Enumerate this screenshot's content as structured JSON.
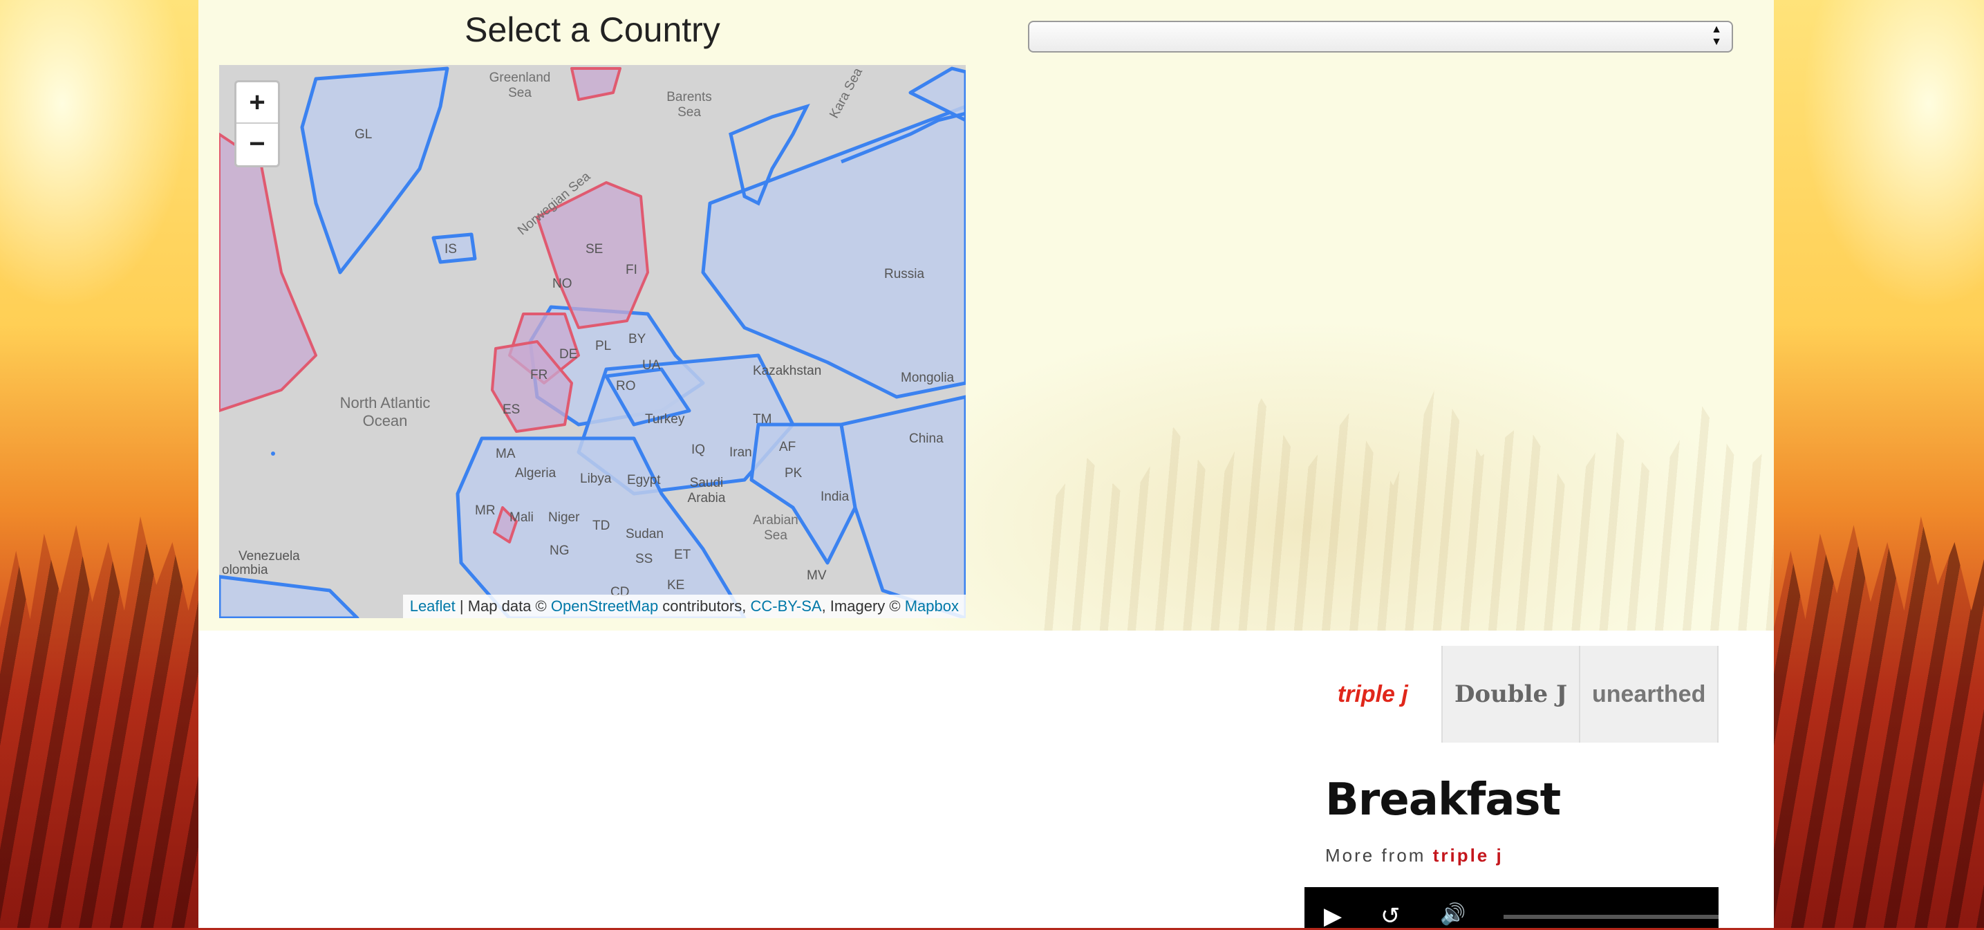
{
  "header": {
    "title": "Select a Country"
  },
  "country_select": {
    "value": ""
  },
  "map": {
    "zoom_in": "+",
    "zoom_out": "−",
    "attribution": {
      "leaflet": "Leaflet",
      "sep": " | Map data © ",
      "osm": "OpenStreetMap",
      "contrib": " contributors, ",
      "license": "CC-BY-SA",
      "imagery": ", Imagery © ",
      "mapbox": "Mapbox"
    },
    "labels": {
      "greenland_sea": "Greenland\nSea",
      "barents_sea": "Barents\nSea",
      "kara_sea": "Kara Sea",
      "gl": "GL",
      "is": "IS",
      "norwegian_sea": "Norwegian Sea",
      "se": "SE",
      "fi": "FI",
      "no": "NO",
      "russia": "Russia",
      "de": "DE",
      "pl": "PL",
      "by": "BY",
      "ua": "UA",
      "fr": "FR",
      "ro": "RO",
      "kazakhstan": "Kazakhstan",
      "mongolia": "Mongolia",
      "north_atlantic": "North Atlantic\nOcean",
      "es": "ES",
      "turkey": "Turkey",
      "tm": "TM",
      "china": "China",
      "ma": "MA",
      "iq": "IQ",
      "iran": "Iran",
      "af": "AF",
      "algeria": "Algeria",
      "libya": "Libya",
      "egypt": "Egypt",
      "saudi": "Saudi\nArabia",
      "pk": "PK",
      "india": "India",
      "mr": "MR",
      "mali": "Mali",
      "niger": "Niger",
      "td": "TD",
      "sudan": "Sudan",
      "arabian_sea": "Arabian\nSea",
      "venezuela": "Venezuela",
      "colombia": "olombia",
      "ng": "NG",
      "ss": "SS",
      "et": "ET",
      "mv": "MV",
      "cd": "CD",
      "ke": "KE"
    }
  },
  "stations": [
    {
      "name": "triple j"
    },
    {
      "name": "Double J"
    },
    {
      "name": "unearthed"
    }
  ],
  "program": {
    "title": "Breakfast",
    "more_prefix": "More from",
    "more_station": "triple j"
  },
  "player": {
    "play": "▶",
    "rewind": "↺",
    "volume": "🔊"
  }
}
